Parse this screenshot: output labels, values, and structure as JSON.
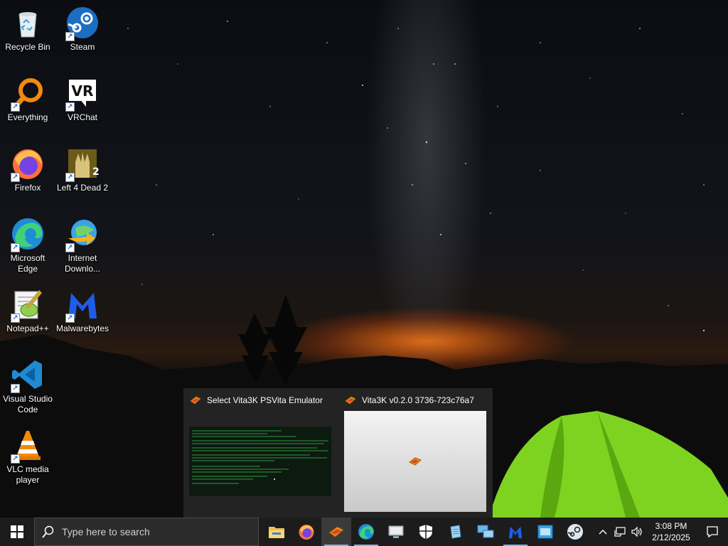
{
  "desktop": {
    "icons": [
      {
        "label": "Recycle Bin",
        "icon": "recycle-bin-icon",
        "shortcut": false
      },
      {
        "label": "Steam",
        "icon": "steam-icon",
        "shortcut": true
      },
      {
        "label": "Everything",
        "icon": "everything-icon",
        "shortcut": true
      },
      {
        "label": "VRChat",
        "icon": "vrchat-icon",
        "shortcut": true
      },
      {
        "label": "Firefox",
        "icon": "firefox-icon",
        "shortcut": true
      },
      {
        "label": "Left 4 Dead 2",
        "icon": "left-4-dead-2-icon",
        "shortcut": true
      },
      {
        "label": "Microsoft Edge",
        "icon": "edge-icon",
        "shortcut": true
      },
      {
        "label": "Internet Downlo...",
        "icon": "internet-download-manager-icon",
        "shortcut": true
      },
      {
        "label": "Notepad++",
        "icon": "notepad-plus-plus-icon",
        "shortcut": true
      },
      {
        "label": "Malwarebytes",
        "icon": "malwarebytes-icon",
        "shortcut": true
      },
      {
        "label": "Visual Studio Code",
        "icon": "vscode-icon",
        "shortcut": true
      },
      {
        "label": "VLC media player",
        "icon": "vlc-icon",
        "shortcut": true
      }
    ],
    "vrchat_logo_text": "VR"
  },
  "thumbnails": [
    {
      "title": "Select Vita3K PSVita Emulator",
      "icon": "vita3k-icon"
    },
    {
      "title": "Vita3K v0.2.0 3736-723c76a7",
      "icon": "vita3k-icon"
    }
  ],
  "taskbar": {
    "search_placeholder": "Type here to search",
    "pinned": [
      {
        "name": "file-explorer",
        "icon": "folder-icon"
      },
      {
        "name": "firefox",
        "icon": "firefox-icon"
      },
      {
        "name": "vita3k",
        "icon": "vita3k-icon"
      },
      {
        "name": "edge",
        "icon": "edge-icon"
      },
      {
        "name": "remote-desktop",
        "icon": "remote-desktop-icon"
      },
      {
        "name": "windows-security",
        "icon": "shield-icon"
      },
      {
        "name": "notepad",
        "icon": "notepad-icon"
      },
      {
        "name": "network-connections",
        "icon": "network-icon"
      },
      {
        "name": "malwarebytes",
        "icon": "malwarebytes-icon"
      },
      {
        "name": "app-window",
        "icon": "app-window-icon"
      },
      {
        "name": "steam",
        "icon": "steam-icon"
      }
    ],
    "time": "3:08 PM",
    "date": "2/12/2025"
  },
  "colors": {
    "taskbar": "#1c1c1c",
    "accent": "#76b9ed",
    "tent": "#7ed321"
  }
}
